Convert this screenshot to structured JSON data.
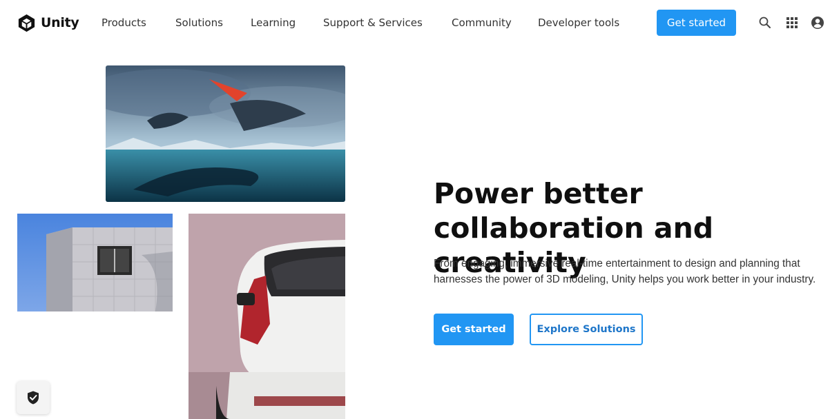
{
  "brand": {
    "name": "Unity"
  },
  "nav": {
    "items": [
      {
        "label": "Products"
      },
      {
        "label": "Solutions"
      },
      {
        "label": "Learning"
      },
      {
        "label": "Support & Services"
      },
      {
        "label": "Community"
      },
      {
        "label": "Developer tools"
      }
    ],
    "cta_label": "Get started",
    "icons": [
      "search-icon",
      "apps-grid-icon",
      "account-icon"
    ]
  },
  "hero": {
    "headline": "Power better collaboration and creativity",
    "body": "From engaging, immersive real-time entertainment to design and planning that harnesses the power of 3D modeling, Unity helps you work better in your industry.",
    "primary_cta": "Get started",
    "secondary_cta": "Explore Solutions"
  },
  "colors": {
    "accent": "#2196f3",
    "text": "#0f0f0f"
  }
}
